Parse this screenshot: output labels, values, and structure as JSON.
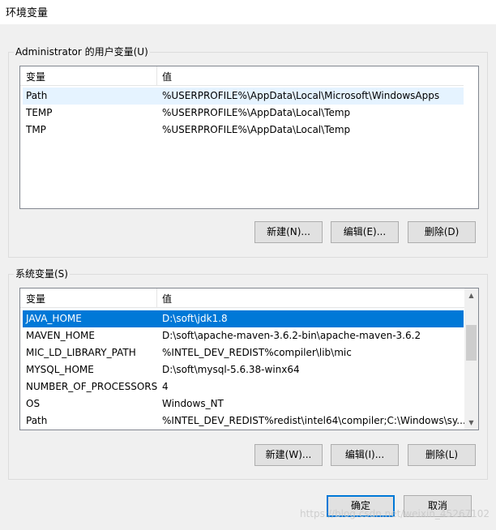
{
  "window": {
    "title": "环境变量"
  },
  "user_vars": {
    "group_label": "Administrator 的用户变量(U)",
    "columns": [
      "变量",
      "值"
    ],
    "rows": [
      {
        "name": "Path",
        "value": "%USERPROFILE%\\AppData\\Local\\Microsoft\\WindowsApps"
      },
      {
        "name": "TEMP",
        "value": "%USERPROFILE%\\AppData\\Local\\Temp"
      },
      {
        "name": "TMP",
        "value": "%USERPROFILE%\\AppData\\Local\\Temp"
      }
    ],
    "buttons": {
      "new": "新建(N)...",
      "edit": "编辑(E)...",
      "delete": "删除(D)"
    }
  },
  "system_vars": {
    "group_label": "系统变量(S)",
    "columns": [
      "变量",
      "值"
    ],
    "rows": [
      {
        "name": "JAVA_HOME",
        "value": "D:\\soft\\jdk1.8"
      },
      {
        "name": "MAVEN_HOME",
        "value": "D:\\soft\\apache-maven-3.6.2-bin\\apache-maven-3.6.2"
      },
      {
        "name": "MIC_LD_LIBRARY_PATH",
        "value": "%INTEL_DEV_REDIST%compiler\\lib\\mic"
      },
      {
        "name": "MYSQL_HOME",
        "value": "D:\\soft\\mysql-5.6.38-winx64"
      },
      {
        "name": "NUMBER_OF_PROCESSORS",
        "value": "4"
      },
      {
        "name": "OS",
        "value": "Windows_NT"
      },
      {
        "name": "Path",
        "value": "%INTEL_DEV_REDIST%redist\\intel64\\compiler;C:\\Windows\\sy..."
      }
    ],
    "buttons": {
      "new": "新建(W)...",
      "edit": "编辑(I)...",
      "delete": "删除(L)"
    }
  },
  "footer": {
    "ok": "确定",
    "cancel": "取消"
  },
  "watermark": "https://blog.csdn.net/weixin_45267102",
  "colors": {
    "selection": "#0078d7",
    "hover": "#e5f3ff",
    "default_button_border": "#0078d7"
  }
}
